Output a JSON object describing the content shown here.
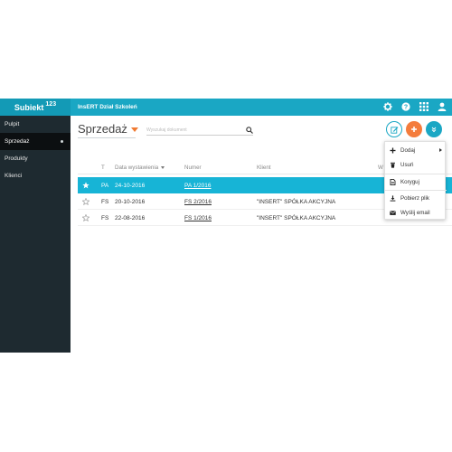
{
  "brand": {
    "name": "Subiekt",
    "version": "123"
  },
  "company": "InsERT Dział Szkoleń",
  "sidebar": {
    "items": [
      {
        "label": "Pulpit"
      },
      {
        "label": "Sprzedaż"
      },
      {
        "label": "Produkty"
      },
      {
        "label": "Klienci"
      }
    ]
  },
  "main": {
    "title": "Sprzedaż",
    "search_placeholder": "Wyszukaj dokument"
  },
  "table": {
    "headers": {
      "type": "T",
      "date": "Data wystawienia",
      "number": "Numer",
      "client": "Klient",
      "value_partial": "W"
    },
    "rows": [
      {
        "type": "PA",
        "date": "24-10-2016",
        "number": "PA 1/2016",
        "client": ""
      },
      {
        "type": "FS",
        "date": "20-10-2016",
        "number": "FS 2/2016",
        "client": "\"INSERT\" SPÓŁKA AKCYJNA"
      },
      {
        "type": "FS",
        "date": "22-08-2016",
        "number": "FS 1/2016",
        "client": "\"INSERT\" SPÓŁKA AKCYJNA"
      }
    ]
  },
  "menu": {
    "items": [
      {
        "label": "Dodaj",
        "icon": "plus-icon"
      },
      {
        "label": "Usuń",
        "icon": "trash-icon"
      },
      {
        "label": "Koryguj",
        "icon": "document-icon"
      },
      {
        "label": "Pobierz plik",
        "icon": "download-icon"
      },
      {
        "label": "Wyślij email",
        "icon": "envelope-icon"
      }
    ]
  },
  "colors": {
    "accent": "#1aa7c4",
    "selected_row": "#17b4d6",
    "orange": "#f47c3c",
    "sidebar": "#1e2a30"
  }
}
